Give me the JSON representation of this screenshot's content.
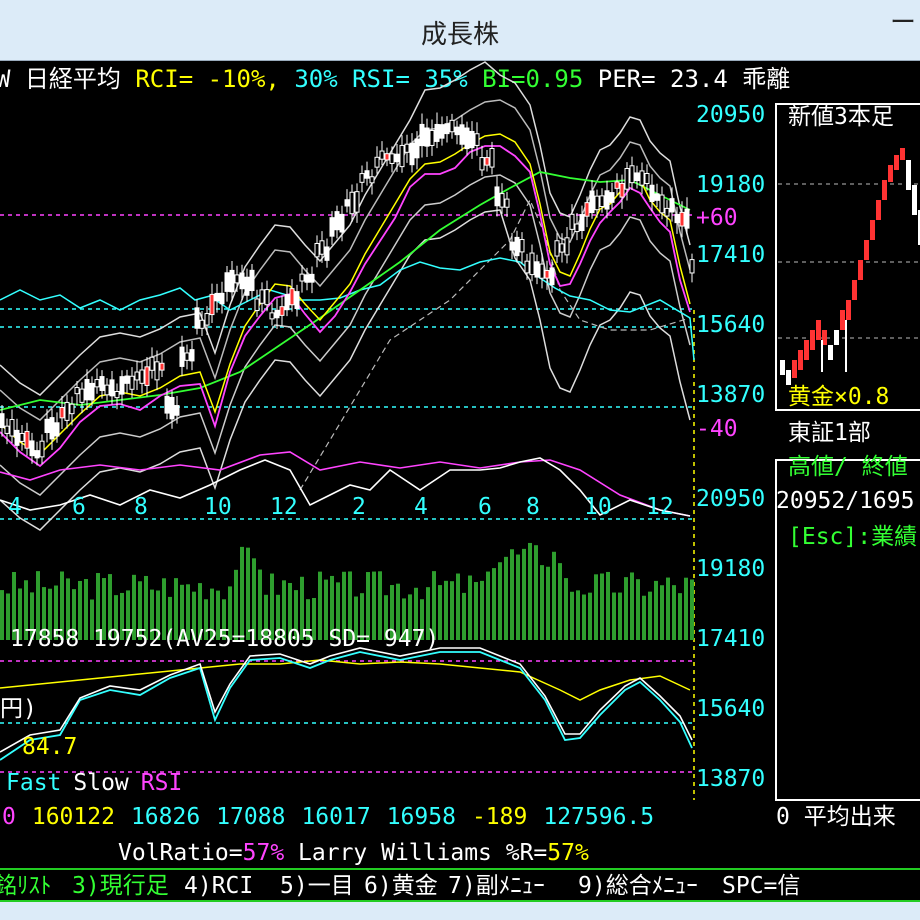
{
  "window": {
    "title": "成長株",
    "minimize_glyph": "ー"
  },
  "header": {
    "parts": [
      {
        "text": "W",
        "color": "#ffffff"
      },
      {
        "text": " 日経平均 ",
        "color": "#ffffff"
      },
      {
        "text": "RCI= -10%, ",
        "color": "#ffff00"
      },
      {
        "text": " 30% RSI= 35% ",
        "color": "#33ffff"
      },
      {
        "text": "BI=0.95 ",
        "color": "#33ff33"
      },
      {
        "text": "PER= 23.4 ",
        "color": "#ffffff"
      },
      {
        "text": " 乖離",
        "color": "#ffffff"
      }
    ]
  },
  "main_chart": {
    "right_axis": [
      "20950",
      "19180",
      "+60",
      "17410",
      "15640",
      "13870",
      "-40",
      "20950"
    ],
    "month_labels": [
      "4",
      "6",
      "8",
      "10",
      "12",
      "2",
      "4",
      "6",
      "8",
      "10",
      "12"
    ]
  },
  "lower_panel": {
    "right_axis": [
      "19180",
      "17410",
      "15640",
      "13870"
    ],
    "ma_line": "17858 19752(AV25=18805 SD= 947)",
    "unit_label": "円)",
    "value_label": "84.7",
    "legend": [
      {
        "text": "Fast",
        "color": "#33ffff"
      },
      {
        "text": "Slow",
        "color": "#ffffff"
      },
      {
        "text": "RSI",
        "color": "#ff44ff"
      }
    ],
    "values_row": [
      {
        "text": "0",
        "color": "#ff44ff"
      },
      {
        "text": "160122",
        "color": "#ffff00"
      },
      {
        "text": "16826",
        "color": "#33ffff"
      },
      {
        "text": "17088",
        "color": "#33ffff"
      },
      {
        "text": "16017",
        "color": "#33ffff"
      },
      {
        "text": "16958",
        "color": "#33ffff"
      },
      {
        "text": "-189",
        "color": "#ffff00"
      },
      {
        "text": "127596.5",
        "color": "#33ffff"
      }
    ],
    "volratio_label": "VolRatio=",
    "volratio_value": "57%",
    "lw_label": "Larry Williams %R=",
    "lw_value": "57%"
  },
  "side_panel": {
    "title": "新値3本足",
    "gold_label": "黄金×0.8",
    "market": "東証1部",
    "hilo_label": "高値/ 終値",
    "hilo_values": "20952/1695",
    "esc_hint": "[Esc]:業績",
    "bottom_label": "0 平均出来"
  },
  "function_keys": [
    {
      "text": "銘ﾘｽﾄ",
      "color": "#33ff33"
    },
    {
      "text": "3)現行足",
      "color": "#33ff33"
    },
    {
      "text": "4)RCI",
      "color": "#ffffff"
    },
    {
      "text": "5)一目",
      "color": "#ffffff"
    },
    {
      "text": "6)黄金",
      "color": "#ffffff"
    },
    {
      "text": "7)副ﾒﾆｭｰ",
      "color": "#ffffff"
    },
    {
      "text": "9)総合ﾒﾆｭｰ",
      "color": "#ffffff"
    },
    {
      "text": "SPC=信",
      "color": "#ffffff"
    }
  ],
  "colors": {
    "cyan": "#33ffff",
    "magenta": "#ff44ff",
    "yellow": "#ffff00",
    "green": "#33ff33",
    "volume": "#2e9e2e",
    "red": "#ff3333"
  }
}
